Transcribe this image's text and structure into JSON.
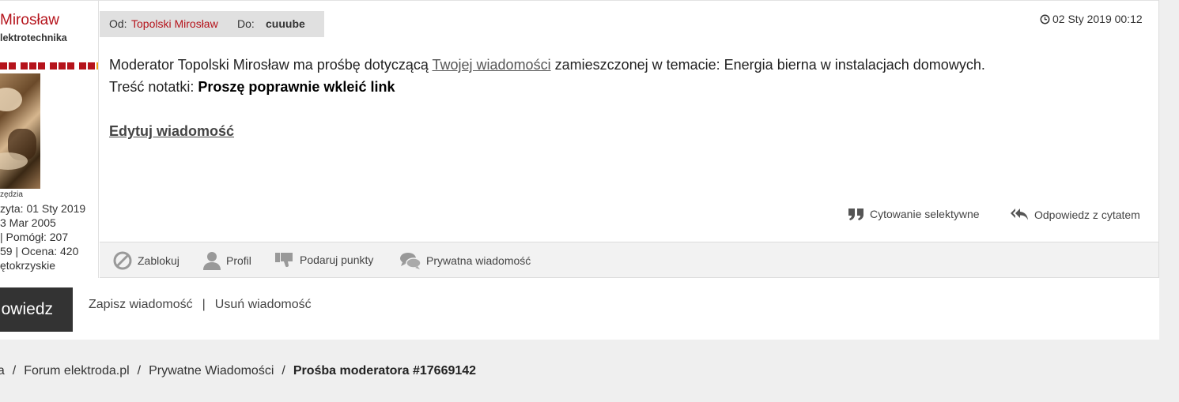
{
  "sender_profile": {
    "username": "Mirosław",
    "rank": "lektrotechnika",
    "avatar_caption": "zędzia",
    "stats": [
      "zyta: 01 Sty 2019",
      "3 Mar 2005",
      " | Pomógł: 207",
      "59 | Ocena: 420",
      "ętokrzyskie"
    ]
  },
  "message_header": {
    "from_label": "Od:",
    "from_name": "Topolski Mirosław",
    "to_label": "Do:",
    "to_name": "cuuube",
    "date": "02 Sty 2019 00:12"
  },
  "message_body": {
    "line1_prefix": "Moderator Topolski Mirosław ma prośbę dotyczącą ",
    "line1_link": "Twojej wiadomości",
    "line1_suffix": " zamieszczonej w temacie: Energia bierna w instalacjach domowych.",
    "note_label": "Treść notatki: ",
    "note_text": "Proszę poprawnie wkleić link",
    "edit_link": "Edytuj wiadomość"
  },
  "quote_actions": {
    "selective_quote": "Cytowanie selektywne",
    "reply_with_quote": "Odpowiedz z cytatem"
  },
  "action_bar": {
    "block": "Zablokuj",
    "profile": "Profil",
    "give_points": "Podaruj punkty",
    "private_message": "Prywatna wiadomość"
  },
  "reply_bar": {
    "reply_button": "owiedz",
    "save_message": "Zapisz wiadomość",
    "separator": "|",
    "delete_message": "Usuń wiadomość"
  },
  "breadcrumb": {
    "items": [
      "na",
      "Forum elektroda.pl",
      "Prywatne Wiadomości"
    ],
    "current": "Prośba moderatora #17669142",
    "separator": "/"
  },
  "colors": {
    "accent_red": "#b5131b",
    "rank_gold": "#f0a21a",
    "reply_button_bg": "#333333",
    "page_bg": "#efefef"
  },
  "icons": {
    "date": "clock-icon",
    "selective_quote": "quote-icon",
    "reply_with_quote": "reply-all-icon",
    "block": "block-icon",
    "profile": "user-icon",
    "give_points": "thumbs-up-icon",
    "private_message": "chat-icon"
  }
}
